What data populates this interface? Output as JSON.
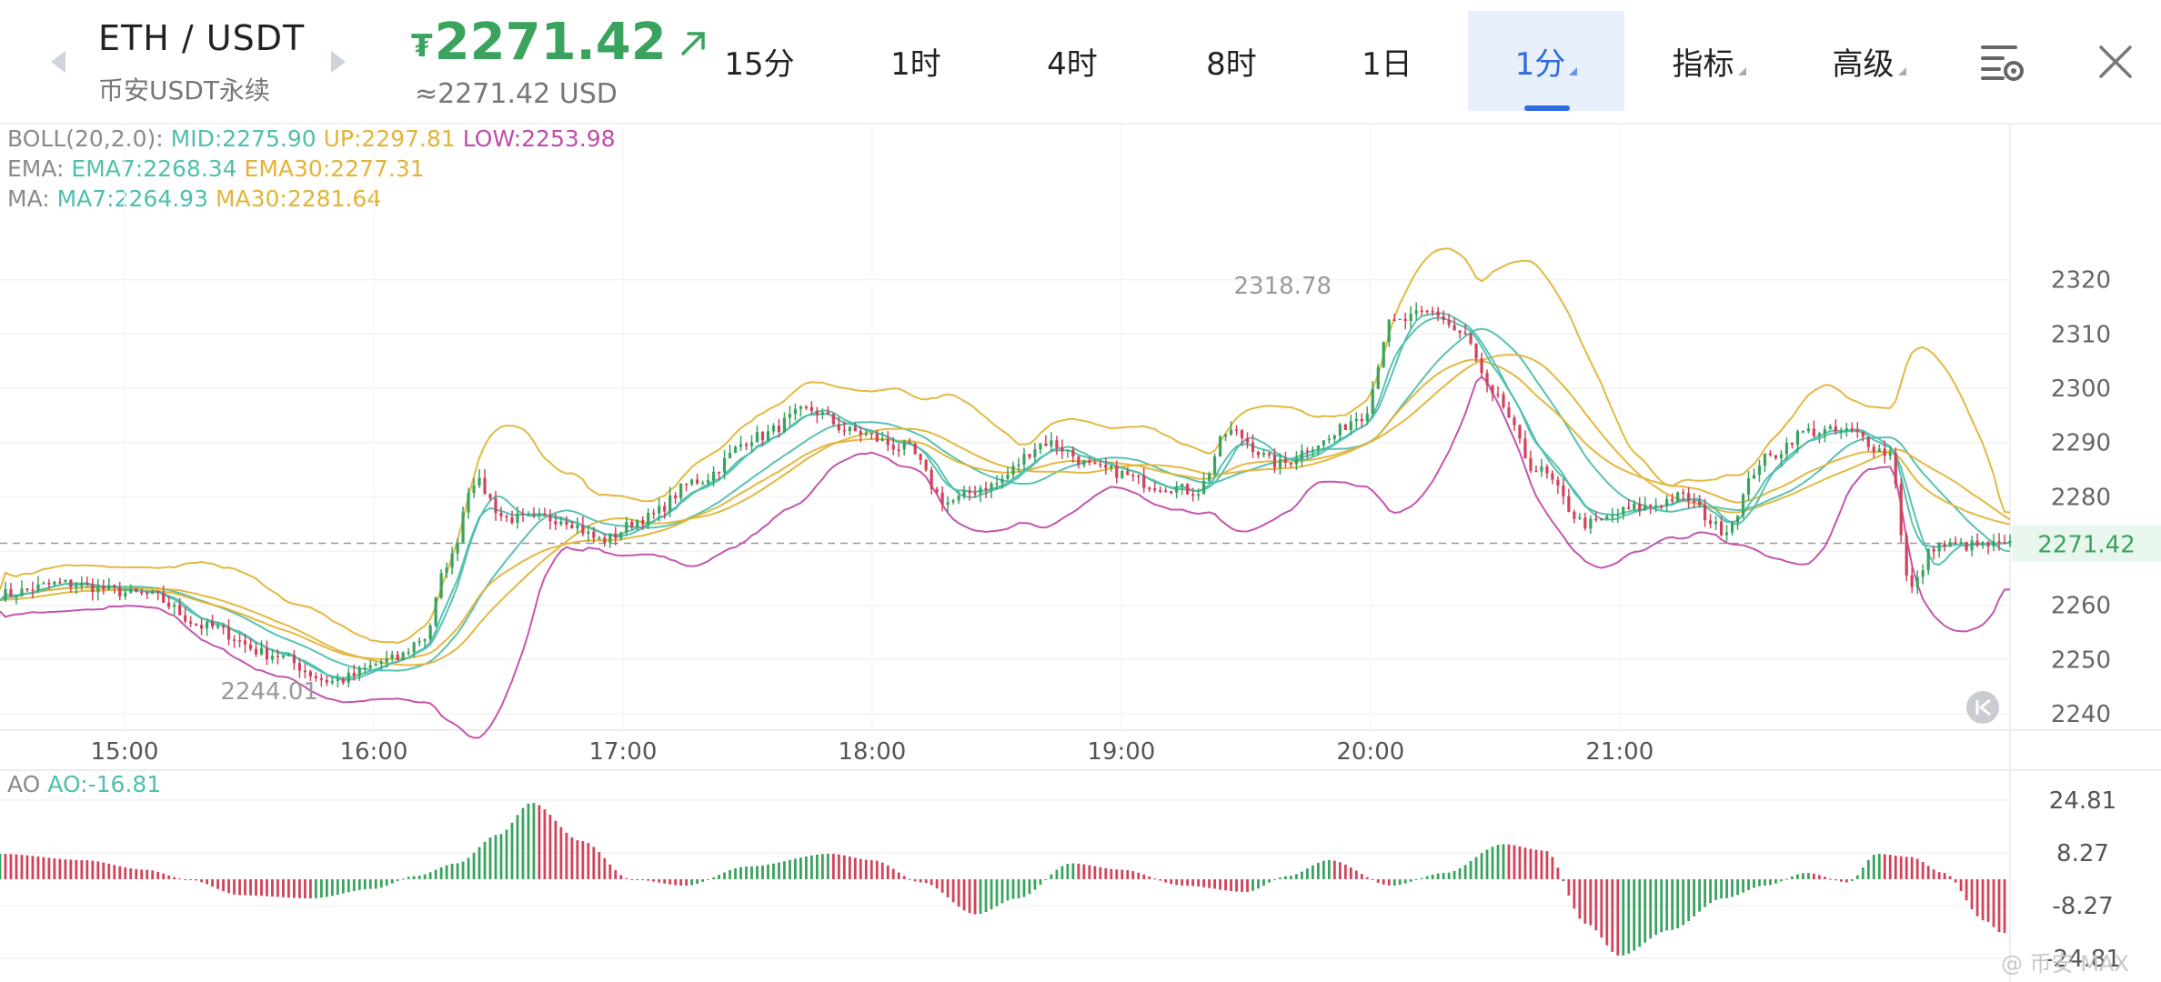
{
  "header": {
    "pair": "ETH / USDT",
    "subtitle": "币安USDT永续",
    "price_symbol": "₮",
    "price": "2271.42",
    "price_usd": "≈2271.42 USD",
    "colors": {
      "up": "#3aa35e",
      "accent": "#2f6bdc",
      "active_bg": "#e8f0fd"
    }
  },
  "tabs": [
    {
      "label": "15分",
      "active": false
    },
    {
      "label": "1时",
      "active": false
    },
    {
      "label": "4时",
      "active": false
    },
    {
      "label": "8时",
      "active": false
    },
    {
      "label": "1日",
      "active": false
    },
    {
      "label": "1分",
      "active": true
    },
    {
      "label": "指标",
      "active": false
    },
    {
      "label": "高级",
      "active": false
    }
  ],
  "icons": {
    "settings": "chart-settings-icon",
    "close": "close-icon",
    "prev": "chevron-left-icon",
    "next": "chevron-right-icon",
    "jump": "jump-to-latest-icon"
  },
  "legend": {
    "boll": {
      "label": "BOLL(20,2.0):",
      "mid": "MID:2275.90",
      "up": "UP:2297.81",
      "low": "LOW:2253.98"
    },
    "ema": {
      "label": "EMA:",
      "ema7": "EMA7:2268.34",
      "ema30": "EMA30:2277.31"
    },
    "ma": {
      "label": "MA:",
      "ma7": "MA7:2264.93",
      "ma30": "MA30:2281.64"
    }
  },
  "ao": {
    "label": "AO",
    "value": "AO:-16.81"
  },
  "watermark": "@ 币安 MAX",
  "chart_data": [
    {
      "type": "line",
      "subtype": "candlestick",
      "x": [
        "15:00",
        "16:00",
        "17:00",
        "18:00",
        "19:00",
        "20:00",
        "21:00"
      ],
      "yticks": [
        2320,
        2310,
        2300,
        2290,
        2280,
        2270,
        2260,
        2250,
        2240
      ],
      "ylim": [
        2237,
        2333
      ],
      "current_price": 2271.42,
      "current_price_label": "2271.42",
      "annotations": [
        {
          "label": "2318.78",
          "value": 2318.78,
          "time": "19:52"
        },
        {
          "label": "2244.01",
          "value": 2244.01,
          "time": "15:48"
        }
      ],
      "anchors": [
        [
          "14:30",
          2262
        ],
        [
          "14:45",
          2264
        ],
        [
          "15:05",
          2262
        ],
        [
          "15:20",
          2256
        ],
        [
          "15:35",
          2251
        ],
        [
          "15:50",
          2246
        ],
        [
          "16:05",
          2250
        ],
        [
          "16:12",
          2254
        ],
        [
          "16:18",
          2268
        ],
        [
          "16:24",
          2283
        ],
        [
          "16:32",
          2276
        ],
        [
          "16:45",
          2276
        ],
        [
          "16:55",
          2272
        ],
        [
          "17:05",
          2276
        ],
        [
          "17:18",
          2283
        ],
        [
          "17:32",
          2291
        ],
        [
          "17:45",
          2296
        ],
        [
          "17:55",
          2292
        ],
        [
          "18:08",
          2289
        ],
        [
          "18:18",
          2279
        ],
        [
          "18:28",
          2282
        ],
        [
          "18:42",
          2290
        ],
        [
          "18:55",
          2285
        ],
        [
          "19:10",
          2282
        ],
        [
          "19:18",
          2281
        ],
        [
          "19:26",
          2292
        ],
        [
          "19:38",
          2286
        ],
        [
          "19:48",
          2290
        ],
        [
          "19:58",
          2295
        ],
        [
          "20:05",
          2312
        ],
        [
          "20:15",
          2314
        ],
        [
          "20:22",
          2310
        ],
        [
          "20:30",
          2298
        ],
        [
          "20:40",
          2285
        ],
        [
          "20:52",
          2275
        ],
        [
          "21:05",
          2278
        ],
        [
          "21:15",
          2280
        ],
        [
          "21:25",
          2274
        ],
        [
          "21:35",
          2287
        ],
        [
          "21:45",
          2292
        ],
        [
          "21:55",
          2292
        ],
        [
          "22:05",
          2288
        ],
        [
          "22:10",
          2263
        ],
        [
          "22:16",
          2271
        ]
      ],
      "series": [
        {
          "name": "MA7",
          "color": "#4fbfae"
        },
        {
          "name": "MA30",
          "color": "#e3b437"
        },
        {
          "name": "EMA7",
          "color": "#4fbfae"
        },
        {
          "name": "EMA30",
          "color": "#e3b437"
        },
        {
          "name": "UP",
          "color": "#e3b437"
        },
        {
          "name": "MID",
          "color": "#4fbfae"
        },
        {
          "name": "LOW",
          "color": "#c24cab"
        }
      ],
      "up_color": "#3aa35e",
      "down_color": "#d2425b",
      "grid": true
    },
    {
      "type": "bar",
      "name": "AO",
      "yticks": [
        "24.81",
        "8.27",
        "-8.27",
        "-24.81"
      ],
      "ylim": [
        -24.81,
        24.81
      ],
      "last_value": -16.81,
      "anchors": [
        [
          "14:30",
          8
        ],
        [
          "14:50",
          6
        ],
        [
          "15:05",
          3
        ],
        [
          "15:15",
          0
        ],
        [
          "15:28",
          -5
        ],
        [
          "15:45",
          -6
        ],
        [
          "16:00",
          -3
        ],
        [
          "16:10",
          1
        ],
        [
          "16:20",
          5
        ],
        [
          "16:30",
          14
        ],
        [
          "16:38",
          24
        ],
        [
          "16:50",
          12
        ],
        [
          "17:02",
          0
        ],
        [
          "17:15",
          -2
        ],
        [
          "17:30",
          4
        ],
        [
          "17:50",
          8
        ],
        [
          "18:00",
          6
        ],
        [
          "18:12",
          -1
        ],
        [
          "18:25",
          -11
        ],
        [
          "18:35",
          -6
        ],
        [
          "18:48",
          5
        ],
        [
          "19:00",
          3
        ],
        [
          "19:15",
          -2
        ],
        [
          "19:30",
          -4
        ],
        [
          "19:40",
          1
        ],
        [
          "19:50",
          6
        ],
        [
          "20:05",
          -2
        ],
        [
          "20:18",
          2
        ],
        [
          "20:32",
          11
        ],
        [
          "20:42",
          9
        ],
        [
          "20:52",
          -14
        ],
        [
          "21:00",
          -24
        ],
        [
          "21:12",
          -16
        ],
        [
          "21:25",
          -6
        ],
        [
          "21:35",
          -2
        ],
        [
          "21:45",
          2
        ],
        [
          "21:55",
          -1
        ],
        [
          "22:02",
          8
        ],
        [
          "22:10",
          7
        ],
        [
          "22:18",
          2
        ],
        [
          "22:28",
          -13
        ],
        [
          "22:32",
          -16.81
        ]
      ]
    }
  ]
}
